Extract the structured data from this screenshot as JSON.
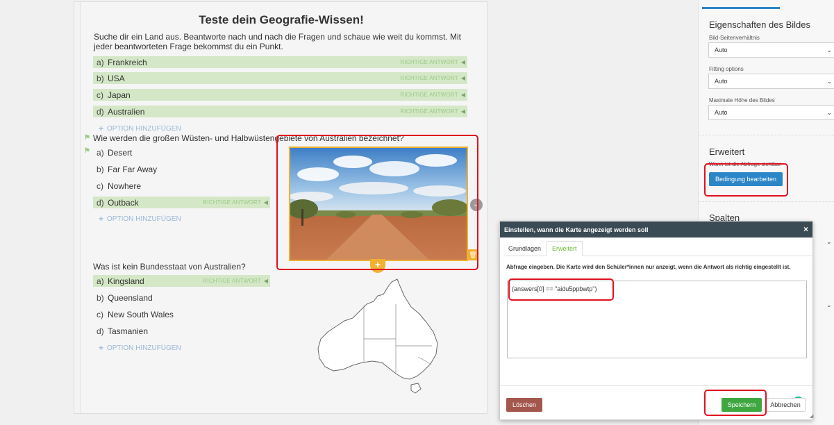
{
  "quiz": {
    "title": "Teste dein Geografie-Wissen!",
    "intro": "Suche dir ein Land aus. Beantworte nach und nach die Fragen und schaue wie weit du kommst. Mit jeder beantworteten Frage bekommst du ein Punkt.",
    "correct_badge": "RICHTIGE ANTWORT",
    "add_option": "OPTION HINZUFÜGEN",
    "q1": {
      "options": [
        {
          "letter": "a)",
          "label": "Frankreich",
          "correct": true
        },
        {
          "letter": "b)",
          "label": "USA",
          "correct": true
        },
        {
          "letter": "c)",
          "label": "Japan",
          "correct": true
        },
        {
          "letter": "d)",
          "label": "Australien",
          "correct": true
        }
      ]
    },
    "q2": {
      "text": "Wie werden die großen Wüsten- und Halbwüstengebiete von Australien bezeichnet?",
      "options": [
        {
          "letter": "a)",
          "label": "Desert",
          "correct": false
        },
        {
          "letter": "b)",
          "label": "Far Far Away",
          "correct": false
        },
        {
          "letter": "c)",
          "label": "Nowhere",
          "correct": false
        },
        {
          "letter": "d)",
          "label": "Outback",
          "correct": true
        }
      ]
    },
    "q3": {
      "text": "Was ist kein Bundesstaat von Australien?",
      "options": [
        {
          "letter": "a)",
          "label": "Kingsland",
          "correct": true
        },
        {
          "letter": "b)",
          "label": "Queensland",
          "correct": false
        },
        {
          "letter": "c)",
          "label": "New South Wales",
          "correct": false
        },
        {
          "letter": "d)",
          "label": "Tasmanien",
          "correct": false
        }
      ]
    },
    "flag_icon": "flag-icon",
    "image_icons": {
      "delete": "trash-icon",
      "add": "plus-icon",
      "handle": "drag-handle-icon"
    }
  },
  "panel": {
    "section_image": "Eigenschaften des Bildes",
    "aspect_label": "Bild-Seitenverhältnis",
    "aspect_value": "Auto",
    "fitting_label": "Fitting options",
    "fitting_value": "Auto",
    "maxheight_label": "Maximale Höhe des Bildes",
    "maxheight_value": "Auto",
    "section_advanced": "Erweitert",
    "visible_label": "Wann ist die Abfrage sichtbar",
    "edit_condition": "Bedingung bearbeiten",
    "section_columns": "Spalten"
  },
  "modal": {
    "title": "Einstellen, wann die Karte angezeigt werden soll",
    "close": "×",
    "tabs": [
      "Grundlagen",
      "Erweitert"
    ],
    "active_tab": "Erweitert",
    "description": "Abfrage eingeben. Die Karte wird den Schüler*innen nur anzeigt, wenn die Antwort als richtig eingestellt ist.",
    "expression": "(answers[0] == \"aidu5ppbwtp\")",
    "delete": "Löschen",
    "save": "Speichern",
    "cancel": "Abbrechen"
  },
  "colors": {
    "accent_blue": "#2b85c6",
    "correct_bg": "#d4e7c6",
    "image_border": "#f0b030",
    "highlight_red": "#e0101e",
    "save_green": "#3fa73f",
    "delete_brown": "#a4574d",
    "modal_header": "#3a4b55"
  }
}
